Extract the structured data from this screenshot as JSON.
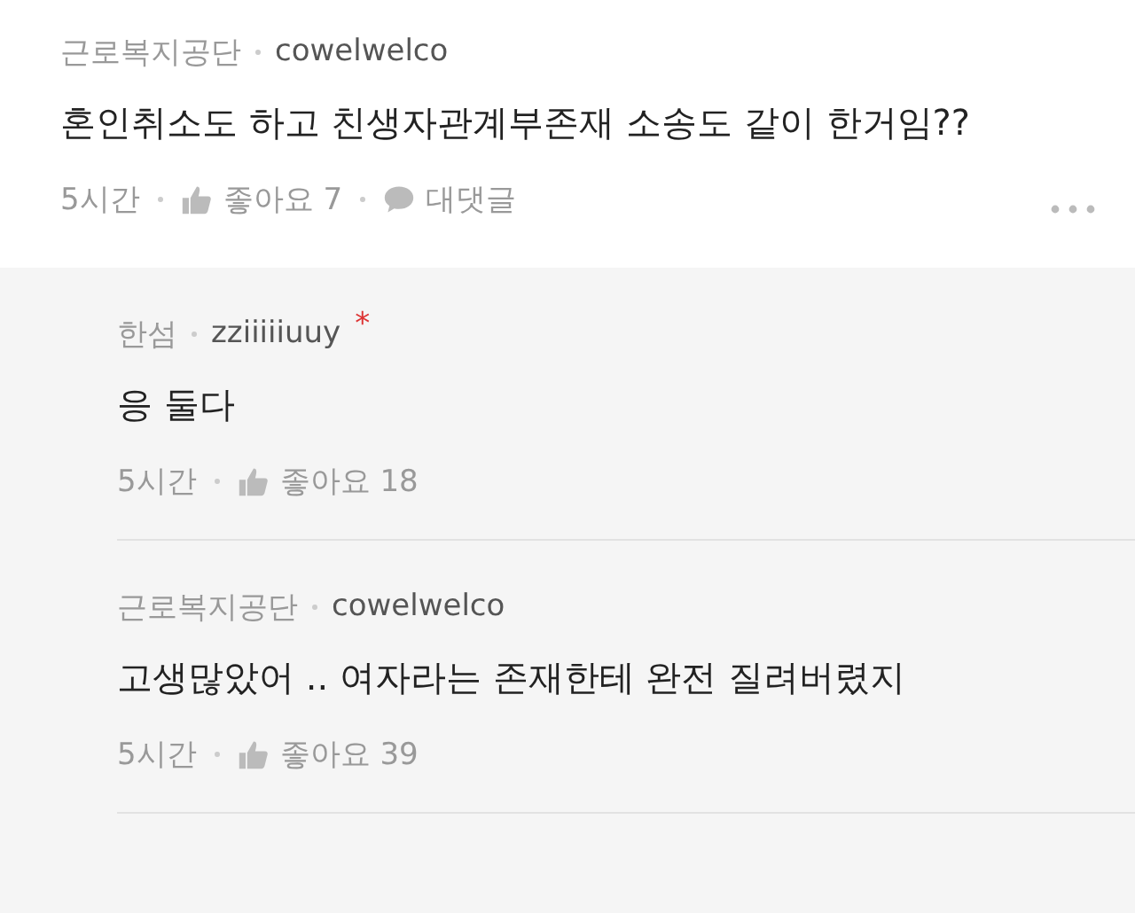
{
  "comment": {
    "group": "근로복지공단",
    "user": "cowelwelco",
    "text": "혼인취소도 하고 친생자관계부존재 소송도 같이 한거임??",
    "time": "5시간",
    "likes": "좋아요 7",
    "reply": "대댓글"
  },
  "replies": [
    {
      "group": "한섬",
      "user": "zziiiiiuuy",
      "mark": "*",
      "text": "응 둘다",
      "time": "5시간",
      "likes": "좋아요 18"
    },
    {
      "group": "근로복지공단",
      "user": "cowelwelco",
      "text": "고생많았어 .. 여자라는 존재한테 완전 질려버렸지",
      "time": "5시간",
      "likes": "좋아요 39"
    }
  ]
}
